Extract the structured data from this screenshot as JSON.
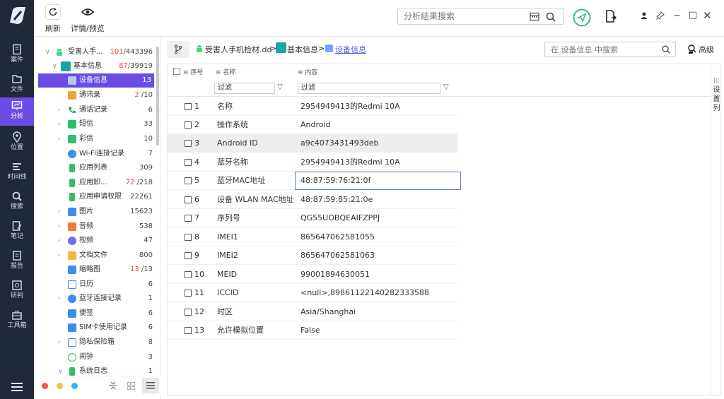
{
  "colors": {
    "accent": "#6b4de6",
    "rail": "#1f2937",
    "link": "#4a5bd6",
    "red": "#e04848",
    "green": "#2bb673"
  },
  "rail": {
    "items": [
      {
        "label": "案件",
        "icon": "case-icon"
      },
      {
        "label": "文件",
        "icon": "folder-icon"
      },
      {
        "label": "分析",
        "icon": "analysis-icon"
      },
      {
        "label": "位置",
        "icon": "location-icon"
      },
      {
        "label": "时间线",
        "icon": "timeline-icon"
      },
      {
        "label": "搜索",
        "icon": "search-icon"
      },
      {
        "label": "笔记",
        "icon": "note-icon"
      },
      {
        "label": "报告",
        "icon": "report-icon"
      },
      {
        "label": "研判",
        "icon": "judge-icon"
      },
      {
        "label": "工具箱",
        "icon": "toolbox-icon"
      }
    ]
  },
  "toolbar": {
    "refresh_label": "刷新",
    "preview_label": "详情/预览",
    "search_placeholder": "分析结果搜索"
  },
  "tree": {
    "items": [
      {
        "label": "受害人手...",
        "count_red": "101",
        "count": "/443396",
        "icon": "android-icon"
      },
      {
        "label": "基本信息",
        "count_red": "87",
        "count": "/39919",
        "icon": "info-icon"
      },
      {
        "label": "设备信息",
        "count": "13",
        "icon": "device-icon"
      },
      {
        "label": "通讯录",
        "count_red": "2",
        "count": " /10",
        "icon": "contacts-icon"
      },
      {
        "label": "通话记录",
        "count": "6",
        "icon": "phone-icon"
      },
      {
        "label": "短信",
        "count": "33",
        "icon": "sms-icon"
      },
      {
        "label": "彩信",
        "count": "10",
        "icon": "mms-icon"
      },
      {
        "label": "Wi-Fi连接记录",
        "count": "7",
        "icon": "wifi-icon"
      },
      {
        "label": "应用列表",
        "count": "309",
        "icon": "app-list-icon"
      },
      {
        "label": "应用卸...",
        "count_red": "72",
        "count": " /218",
        "icon": "uninstall-icon"
      },
      {
        "label": "应用申请权限",
        "count": "22261",
        "icon": "permission-icon"
      },
      {
        "label": "图片",
        "count": "15623",
        "icon": "image-icon"
      },
      {
        "label": "音频",
        "count": "538",
        "icon": "audio-icon"
      },
      {
        "label": "视频",
        "count": "47",
        "icon": "video-icon"
      },
      {
        "label": "文档文件",
        "count": "800",
        "icon": "document-icon"
      },
      {
        "label": "缩略图",
        "count_red": "13",
        "count": " /13",
        "icon": "thumbnail-icon"
      },
      {
        "label": "日历",
        "count": "6",
        "icon": "calendar-icon"
      },
      {
        "label": "蓝牙连接记录",
        "count": "1",
        "icon": "bluetooth-icon"
      },
      {
        "label": "便签",
        "count": "6",
        "icon": "memo-icon"
      },
      {
        "label": "SIM卡使用记录",
        "count": "6",
        "icon": "sim-icon"
      },
      {
        "label": "隐私保险箱",
        "count": "8",
        "icon": "safe-icon"
      },
      {
        "label": "闹钟",
        "count": "3",
        "icon": "alarm-icon"
      },
      {
        "label": "系统日志",
        "count": "1",
        "icon": "log-icon"
      }
    ]
  },
  "breadcrumb": {
    "root": "受害人手机检材.dd",
    "sep": ">",
    "mid": "基本信息",
    "current": "设备信息"
  },
  "inner_search": {
    "placeholder": "在 设备信息 中搜索",
    "advanced_label": "高级"
  },
  "table": {
    "headers": {
      "no": "序号",
      "name": "名称",
      "content": "内容"
    },
    "filter_label": "过滤",
    "settings_label": "设置列",
    "rows": [
      {
        "no": "1",
        "name": "名称",
        "value": "2954949413的Redmi 10A"
      },
      {
        "no": "2",
        "name": "操作系统",
        "value": "Android"
      },
      {
        "no": "3",
        "name": "Android ID",
        "value": "a9c4073431493deb"
      },
      {
        "no": "4",
        "name": "蓝牙名称",
        "value": "2954949413的Redmi 10A"
      },
      {
        "no": "5",
        "name": "蓝牙MAC地址",
        "value": "48:87:59:76:21:0f"
      },
      {
        "no": "6",
        "name": "设备 WLAN MAC地址",
        "value": "48:87:59:85:21:0e"
      },
      {
        "no": "7",
        "name": "序列号",
        "value": "QG55UOBQEAIFZPPJ"
      },
      {
        "no": "8",
        "name": "IMEI1",
        "value": "865647062581055"
      },
      {
        "no": "9",
        "name": "IMEI2",
        "value": "865647062581063"
      },
      {
        "no": "10",
        "name": "MEID",
        "value": "99001894630051"
      },
      {
        "no": "11",
        "name": "ICCID",
        "value": "<null>,89861122140282333588"
      },
      {
        "no": "12",
        "name": "时区",
        "value": "Asia/Shanghai"
      },
      {
        "no": "13",
        "name": "允许模拟位置",
        "value": "False"
      }
    ]
  }
}
